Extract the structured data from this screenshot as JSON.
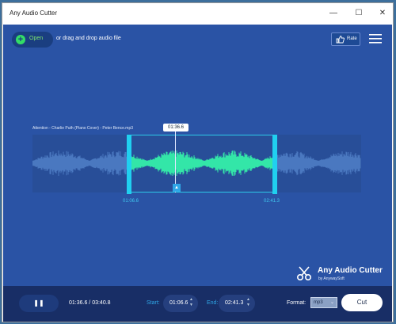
{
  "window": {
    "title": "Any Audio Cutter"
  },
  "header": {
    "open_label": "Open",
    "drag_text": "or drag and drop audio file",
    "rate_label": "Rate"
  },
  "track": {
    "filename": "Attention - Charlie Puth (Piano Cover) - Peter Bence.mp3",
    "playhead_time": "01:36.6",
    "start_mark": "01:06.6",
    "end_mark": "02:41.3",
    "selection_start_fraction": 0.293,
    "selection_end_fraction": 0.741,
    "playhead_fraction": 0.433
  },
  "brand": {
    "name": "Any Audio Cutter",
    "sub": "by AnywaySoft"
  },
  "bottom": {
    "pause_icon": "pause-icon",
    "elapsed": "01:36.6 / 03:40.8",
    "start_label": "Start:",
    "start_value": "01:06.6",
    "end_label": "End:",
    "end_value": "02:41.3",
    "format_label": "Format:",
    "format_value": "mp3",
    "cut_label": "Cut"
  },
  "colors": {
    "background": "#2a53a5",
    "bottom_bar": "#182e66",
    "accent_cyan": "#20d0f0",
    "wave_selected": "#33e6a8",
    "wave_unselected": "#4a78c0",
    "open_green": "#33dd66"
  }
}
